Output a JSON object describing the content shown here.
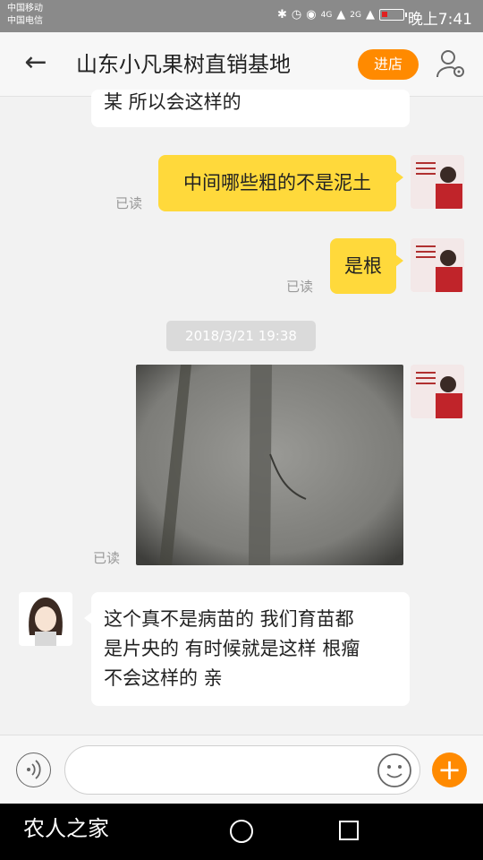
{
  "status_bar": {
    "carrier_1": "中国移动",
    "carrier_2": "中国电信",
    "network": "4G",
    "network_2": "2G",
    "time": "晚上7:41"
  },
  "header": {
    "title": "山东小凡果树直销基地",
    "store_button": "进店"
  },
  "messages": {
    "partial_text": "某 所以会这样的",
    "msg1_text": "中间哪些粗的不是泥土",
    "msg1_status": "已读",
    "msg2_text": "是根",
    "msg2_status": "已读",
    "timestamp": "2018/3/21 19:38",
    "photo_status": "已读",
    "reply_line1": "这个真不是病苗的 我们育苗都",
    "reply_line2": "是片央的 有时候就是这样 根瘤",
    "reply_line3": "不会这样的 亲"
  },
  "navbar": {
    "watermark": "农人之家"
  },
  "colors": {
    "accent": "#ff8a00",
    "bubble_mine": "#ffd93b",
    "bubble_theirs": "#ffffff"
  }
}
